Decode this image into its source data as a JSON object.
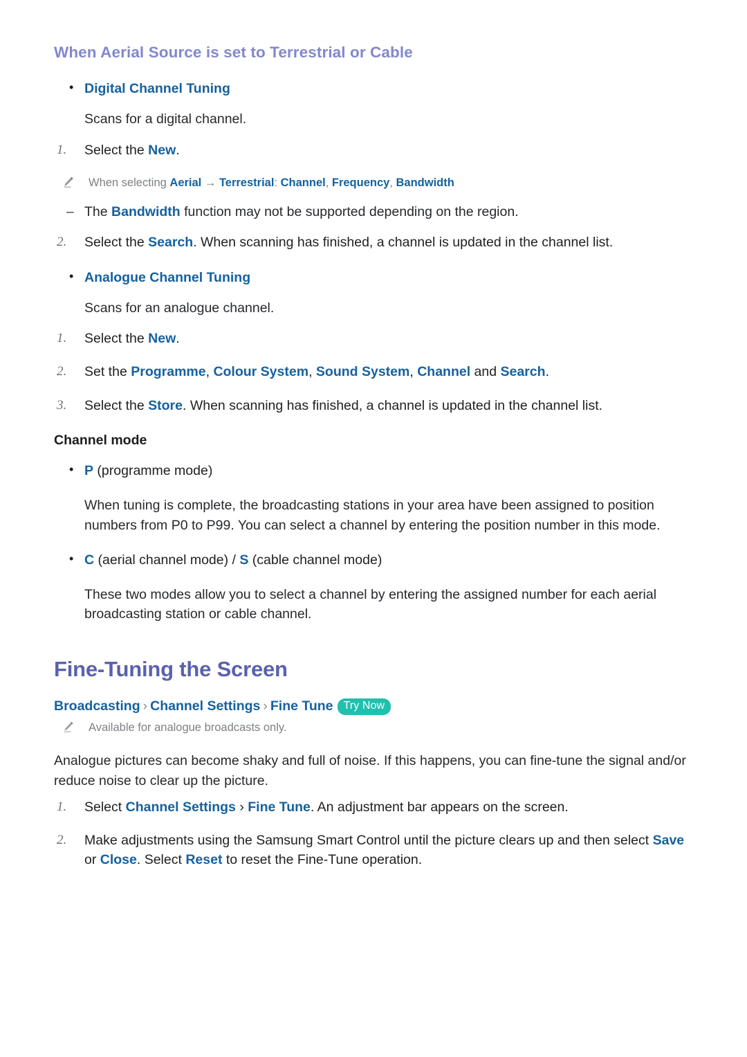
{
  "document": {
    "section_heading": "When Aerial Source is set to Terrestrial or Cable",
    "chapter_heading": "Fine-Tuning the Screen"
  },
  "colors": {
    "section_heading": "#8287cf",
    "chapter_heading": "#5a61ae",
    "link_blue": "#15619f",
    "note_grey": "#7c8185",
    "badge_teal": "#21bfae",
    "body_text": "#26282b"
  },
  "digital_tuning": {
    "title": "Digital Channel Tuning",
    "description": "Scans for a digital channel.",
    "step1": {
      "number": "1.",
      "lead": "Select the ",
      "term": "New",
      "tail": "."
    },
    "note": {
      "icon": "pencil-icon",
      "lead": "When selecting ",
      "term_aerial": "Aerial",
      "arrow": " → ",
      "term_terrestrial": "Terrestrial",
      "colon": ": ",
      "term_channel": "Channel",
      "comma1": ", ",
      "term_frequency": "Frequency",
      "comma2": ", ",
      "term_bandwidth": "Bandwidth"
    },
    "dash_note": {
      "lead": "The ",
      "term": "Bandwidth",
      "tail": " function may not be supported depending on the region."
    },
    "step2": {
      "number": "2.",
      "lead": "Select the ",
      "term": "Search",
      "tail": ". When scanning has finished, a channel is updated in the channel list."
    }
  },
  "analogue_tuning": {
    "title": "Analogue Channel Tuning",
    "description": "Scans for an analogue channel.",
    "step1": {
      "number": "1.",
      "lead": "Select the ",
      "term": "New",
      "tail": "."
    },
    "step2": {
      "number": "2.",
      "lead": "Set the ",
      "term_programme": "Programme",
      "comma1": ", ",
      "term_colour_system": "Colour System",
      "comma2": ", ",
      "term_sound_system": "Sound System",
      "comma3": ", ",
      "term_channel": "Channel",
      "and": " and ",
      "term_search": "Search",
      "tail": "."
    },
    "step3": {
      "number": "3.",
      "lead": "Select the ",
      "term": "Store",
      "tail": ". When scanning has finished, a channel is updated in the channel list."
    }
  },
  "channel_mode": {
    "title": "Channel mode",
    "item_p": {
      "term": "P",
      "tail": " (programme mode)"
    },
    "para_p": "When tuning is complete, the broadcasting stations in your area have been assigned to position numbers from P0 to P99. You can select a channel by entering the position number in this mode.",
    "item_cs": {
      "term_c": "C",
      "mid": " (aerial channel mode) / ",
      "term_s": "S",
      "tail": " (cable channel mode)"
    },
    "para_cs": "These two modes allow you to select a channel by entering the assigned number for each aerial broadcasting station or cable channel."
  },
  "fine_tuning": {
    "breadcrumb": {
      "item1": "Broadcasting",
      "chevron": "›",
      "item2": "Channel Settings",
      "item3": "Fine Tune",
      "badge": "Try Now"
    },
    "note": {
      "icon": "pencil-icon",
      "text": "Available for analogue broadcasts only."
    },
    "intro": "Analogue pictures can become shaky and full of noise. If this happens, you can fine-tune the signal and/or reduce noise to clear up the picture.",
    "step1": {
      "number": "1.",
      "lead": "Select ",
      "term1": "Channel Settings",
      "chevron": " › ",
      "term2": "Fine Tune",
      "tail": ". An adjustment bar appears on the screen."
    },
    "step2": {
      "number": "2.",
      "lead": "Make adjustments using the Samsung Smart Control until the picture clears up and then select ",
      "term_save": "Save",
      "or": " or ",
      "term_close": "Close",
      "mid": ". Select ",
      "term_reset": "Reset",
      "tail": " to reset the Fine-Tune operation."
    }
  }
}
